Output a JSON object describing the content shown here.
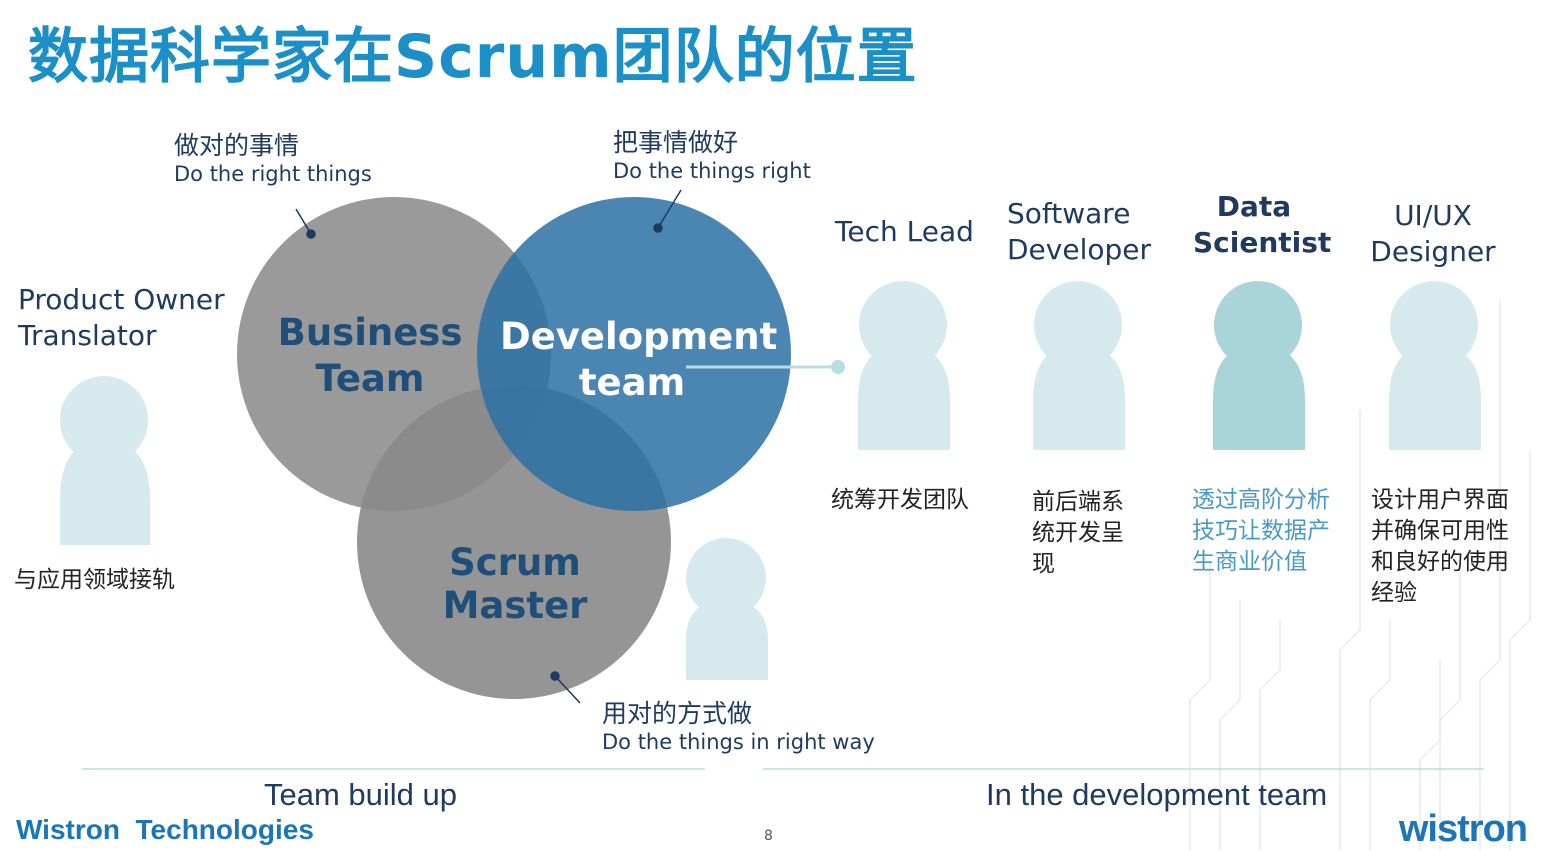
{
  "title": "数据科学家在Scrum团队的位置",
  "venn": {
    "business": {
      "line1": "Business",
      "line2": "Team"
    },
    "development": {
      "line1": "Development",
      "line2": "team"
    },
    "scrum": {
      "label": "Scrum Master"
    }
  },
  "annotations": {
    "right_things": {
      "cn": "做对的事情",
      "en": "Do the right things"
    },
    "things_right": {
      "cn": "把事情做好",
      "en": "Do the things right"
    },
    "right_way": {
      "cn": "用对的方式做",
      "en": "Do the things in right way"
    }
  },
  "product_owner": {
    "line1": "Product Owner",
    "line2": "Translator",
    "desc": "与应用领域接轨"
  },
  "roles": [
    {
      "line1": "Tech Lead",
      "line2": "",
      "desc": [
        "统筹开发团队"
      ]
    },
    {
      "line1": "Software",
      "line2": "Developer",
      "desc": [
        "前后端系",
        "统开发呈",
        "现"
      ]
    },
    {
      "line1": "Data",
      "line2": "Scientist",
      "desc": [
        "透过高阶分析",
        "技巧让数据产",
        "生商业价值"
      ]
    },
    {
      "line1": "UI/UX",
      "line2": "Designer",
      "desc": [
        "设计用户界面",
        "并确保可用性",
        "和良好的使用",
        "经验"
      ]
    }
  ],
  "footer": {
    "left": "Team build up",
    "right": "In the development team",
    "brand": "Wistron  Technologies",
    "page": "8",
    "logo": "wistron"
  },
  "colors": {
    "title": "#1b8fc7",
    "business": "#8c8c8c",
    "development": "#2f74a8",
    "scrum": "#8c8c8c",
    "person": "#d6eaee",
    "person_highlight": "#a8d3d9"
  }
}
